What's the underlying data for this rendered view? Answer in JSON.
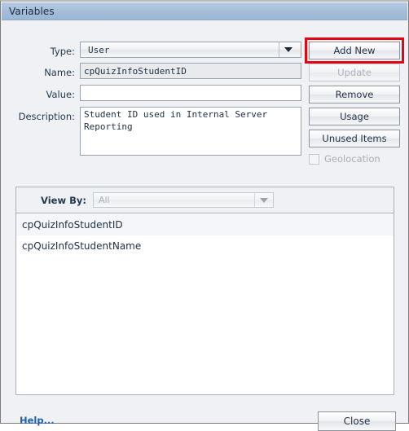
{
  "window": {
    "title": "Variables"
  },
  "form": {
    "type": {
      "label": "Type:",
      "value": "User",
      "arrow_icon": "chevron-down-icon"
    },
    "name": {
      "label": "Name:",
      "value": "cpQuizInfoStudentID",
      "placeholder": ""
    },
    "value": {
      "label": "Value:",
      "value": "",
      "placeholder": ""
    },
    "description": {
      "label": "Description:",
      "value": "Student ID used in Internal Server Reporting",
      "placeholder": ""
    }
  },
  "actions": {
    "add_new": "Add New",
    "update": "Update",
    "remove": "Remove",
    "usage": "Usage",
    "unused_items": "Unused Items",
    "geolocation": "Geolocation"
  },
  "highlight": {
    "target": "Add New",
    "color": "#e30613"
  },
  "list_panel": {
    "view_by_label": "View By:",
    "view_by_value": "All",
    "view_by_arrow_icon": "chevron-down-icon",
    "items": [
      {
        "name": "cpQuizInfoStudentID",
        "selected": true
      },
      {
        "name": "cpQuizInfoStudentName",
        "selected": false
      }
    ]
  },
  "footer": {
    "help": "Help...",
    "close": "Close"
  }
}
